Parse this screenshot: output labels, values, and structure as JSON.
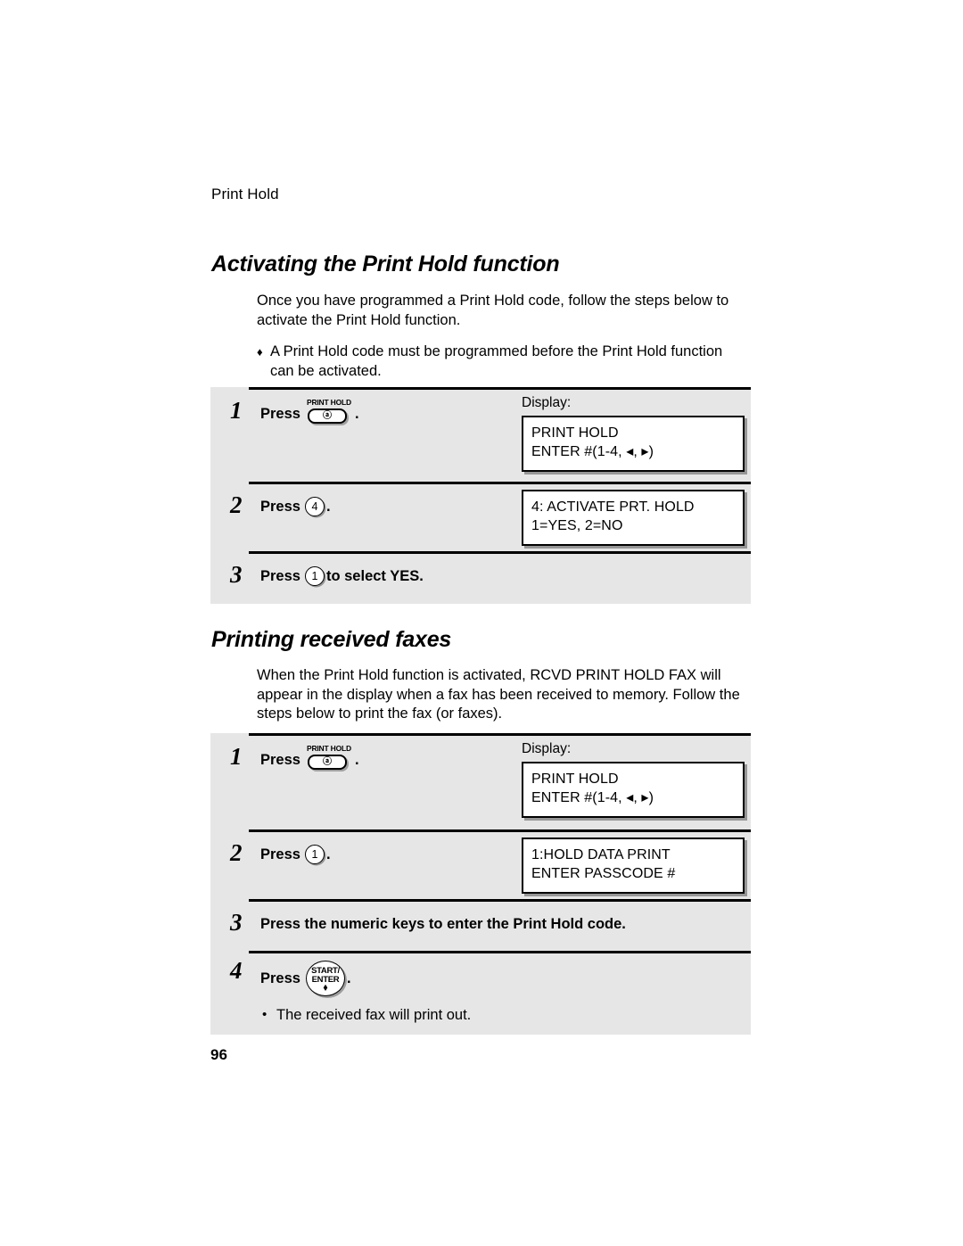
{
  "page": {
    "running_header": "Print Hold",
    "page_number": "96"
  },
  "sections": [
    {
      "heading": "Activating the Print Hold function",
      "paragraph": "Once you have programmed a Print Hold code, follow the steps below to activate the Print Hold function.",
      "note": {
        "bullet": "♦",
        "text": "A Print Hold code must be programmed before the Print Hold function can be activated."
      }
    },
    {
      "heading": "Printing received faxes",
      "paragraph": "When the Print Hold function is activated, RCVD PRINT HOLD FAX will appear in the display when a fax has been received to memory. Follow the steps below to print the fax (or faxes)."
    }
  ],
  "steps_table_1": {
    "rows": [
      {
        "number": "1",
        "press_label": "Press",
        "key": {
          "type": "print-hold-key",
          "caption": "PRINT HOLD",
          "symbol": "ⓐ"
        },
        "trailing": ".",
        "display_label": "Display:",
        "display_lines": [
          "PRINT HOLD",
          "ENTER #(1-4, ◂, ▸)"
        ]
      },
      {
        "number": "2",
        "press_label": "Press",
        "key": {
          "type": "numeric-key",
          "symbol": "4"
        },
        "trailing": ".",
        "display_label": "",
        "display_lines": [
          "4: ACTIVATE PRT. HOLD",
          "1=YES, 2=NO"
        ]
      },
      {
        "number": "3",
        "press_label": "Press",
        "key": {
          "type": "numeric-key",
          "symbol": "1"
        },
        "trailing": " to select YES.",
        "display_label": "",
        "display_lines": []
      }
    ]
  },
  "steps_table_2": {
    "rows": [
      {
        "number": "1",
        "press_label": "Press",
        "key": {
          "type": "print-hold-key",
          "caption": "PRINT HOLD",
          "symbol": "ⓐ"
        },
        "trailing": ".",
        "display_label": "Display:",
        "display_lines": [
          "PRINT HOLD",
          "ENTER #(1-4, ◂, ▸)"
        ]
      },
      {
        "number": "2",
        "press_label": "Press",
        "key": {
          "type": "numeric-key",
          "symbol": "1"
        },
        "trailing": ".",
        "display_label": "",
        "display_lines": [
          "1:HOLD DATA PRINT",
          "ENTER PASSCODE #"
        ]
      },
      {
        "number": "3",
        "text_only": "Press the numeric keys to enter the Print Hold code.",
        "display_label": "",
        "display_lines": []
      },
      {
        "number": "4",
        "press_label": "Press",
        "key": {
          "type": "start-enter-key",
          "line1": "START/",
          "line2": "ENTER",
          "symbol": "⬧"
        },
        "trailing": ".",
        "sub_bullet": {
          "dot": "•",
          "text": "The received fax will print out."
        },
        "display_label": "",
        "display_lines": []
      }
    ]
  }
}
